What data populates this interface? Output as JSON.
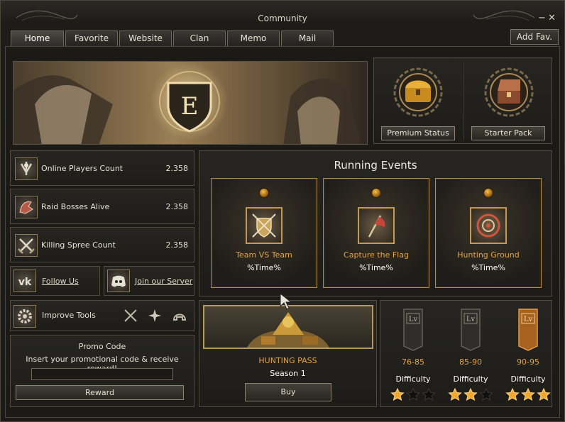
{
  "window": {
    "title": "Community"
  },
  "tabs": [
    "Home",
    "Favorite",
    "Website",
    "Clan",
    "Memo",
    "Mail"
  ],
  "add_fav_label": "Add Fav.",
  "shop": {
    "premium_label": "Premium Status",
    "starter_label": "Starter Pack"
  },
  "stats": [
    {
      "label": "Online Players Count",
      "value": "2.358",
      "icon": "angel-statue-icon"
    },
    {
      "label": "Raid Bosses Alive",
      "value": "2.358",
      "icon": "dragon-boss-icon"
    },
    {
      "label": "Killing Spree Count",
      "value": "2.358",
      "icon": "crossed-swords-icon"
    }
  ],
  "social": {
    "follow_label": "Follow Us",
    "join_label": "Join our Server"
  },
  "tools": {
    "label": "Improve Tools"
  },
  "promo": {
    "title": "Promo Code",
    "description": "Insert your promotional code & receive reward!",
    "input_value": "",
    "button_label": "Reward"
  },
  "events": {
    "title": "Running Events",
    "items": [
      {
        "name": "Team VS Team",
        "time": "%Time%",
        "icon": "shield-swords-icon"
      },
      {
        "name": "Capture the Flag",
        "time": "%Time%",
        "icon": "flag-icon"
      },
      {
        "name": "Hunting Ground",
        "time": "%Time%",
        "icon": "target-icon"
      }
    ]
  },
  "hunting_pass": {
    "title": "HUNTING PASS",
    "season": "Season 1",
    "buy_label": "Buy"
  },
  "levels": {
    "badge_text": "Lv",
    "items": [
      {
        "range": "76-85",
        "difficulty": "Difficulty",
        "stars": 1,
        "active": false
      },
      {
        "range": "85-90",
        "difficulty": "Difficulty",
        "stars": 2,
        "active": false
      },
      {
        "range": "90-95",
        "difficulty": "Difficulty",
        "stars": 3,
        "active": true
      }
    ],
    "max_stars": 3
  },
  "colors": {
    "accent": "#e2a34a",
    "gold": "#c49b53",
    "text": "#e8e2d4"
  }
}
